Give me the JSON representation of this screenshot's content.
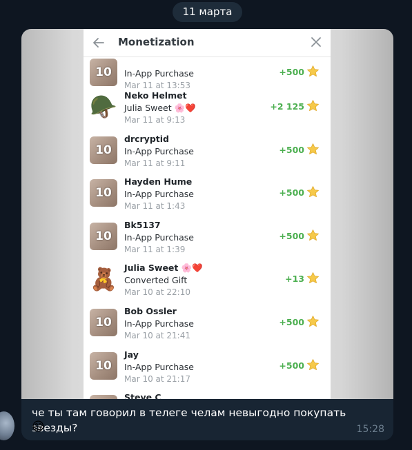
{
  "date_label": "11 марта",
  "panel": {
    "title": "Monetization"
  },
  "rows": [
    {
      "name": "",
      "desc": "In-App Purchase",
      "date": "Mar 11 at 13:53",
      "amount": "+500",
      "thumb": "10"
    },
    {
      "name": "Neko Helmet",
      "desc": "Julia Sweet 🌸❤️",
      "date": "Mar 11 at 9:13",
      "amount": "+2 125",
      "thumb": "🪖"
    },
    {
      "name": "drcryptid",
      "desc": "In-App Purchase",
      "date": "Mar 11 at 9:11",
      "amount": "+500",
      "thumb": "10"
    },
    {
      "name": "Hayden Hume",
      "desc": "In-App Purchase",
      "date": "Mar 11 at 1:43",
      "amount": "+500",
      "thumb": "10"
    },
    {
      "name": "Bk5137",
      "desc": "In-App Purchase",
      "date": "Mar 11 at 1:39",
      "amount": "+500",
      "thumb": "10"
    },
    {
      "name": "Julia Sweet 🌸❤️",
      "desc": "Converted Gift",
      "date": "Mar 10 at 22:10",
      "amount": "+13",
      "thumb": "🧸"
    },
    {
      "name": "Bob Ossler",
      "desc": "In-App Purchase",
      "date": "Mar 10 at 21:41",
      "amount": "+500",
      "thumb": "10"
    },
    {
      "name": "Jay",
      "desc": "In-App Purchase",
      "date": "Mar 10 at 21:17",
      "amount": "+500",
      "thumb": "10"
    },
    {
      "name": "Steve C",
      "desc": "",
      "date": "",
      "amount": "",
      "thumb": "10"
    }
  ],
  "message": {
    "text": "че ты там говорил в телеге челам невыгодно покупать звезды?",
    "emoji": "😅",
    "time": "15:28"
  },
  "colors": {
    "positive_amount": "#4caf50",
    "chat_background": "#0e1621",
    "bubble": "#182533"
  }
}
